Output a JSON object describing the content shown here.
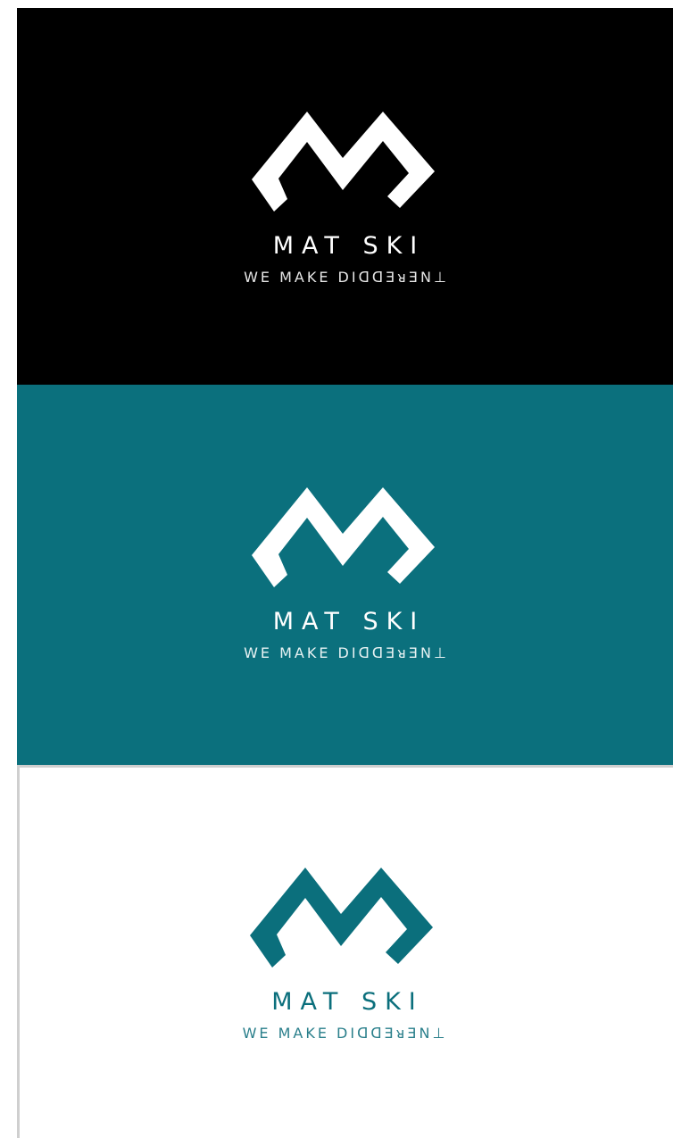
{
  "logo": {
    "wordmark": "MAT SKI",
    "tagline": "WE MAKE DIᗡᗡƎᴚƎN⊥",
    "mark": "m-chevron-icon"
  },
  "variants": [
    {
      "name": "black",
      "background": "#000000",
      "foreground": "#ffffff",
      "tagline_color": "#e6e6e6"
    },
    {
      "name": "teal",
      "background": "#0b707d",
      "foreground": "#ffffff",
      "tagline_color": "#e8f2f3"
    },
    {
      "name": "white",
      "background": "#ffffff",
      "foreground": "#0b6f7c",
      "tagline_color": "#2a7f8b"
    }
  ]
}
